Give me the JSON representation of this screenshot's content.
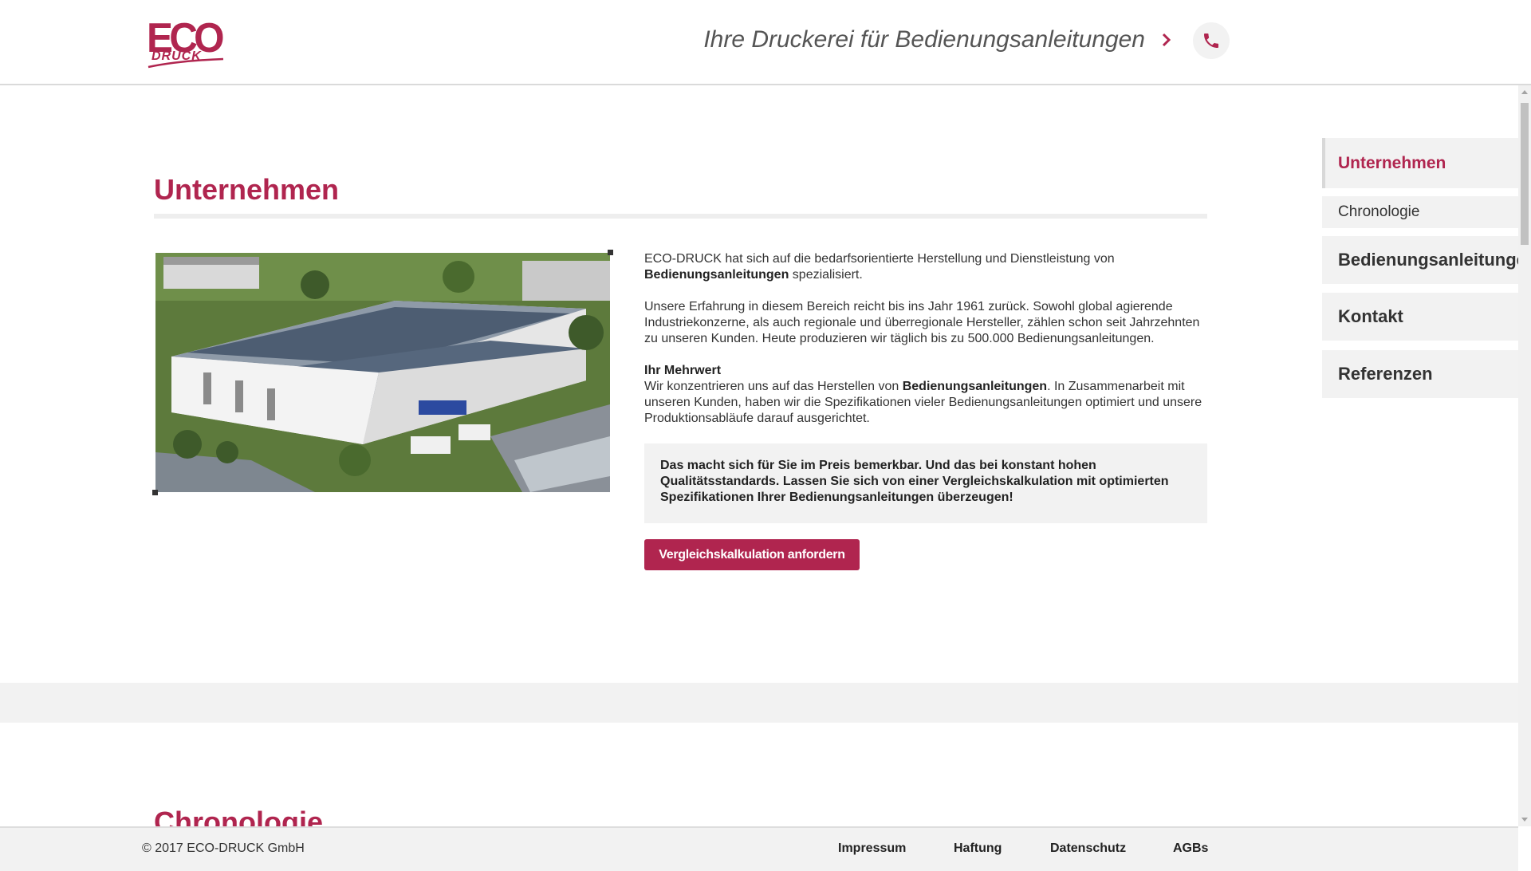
{
  "header": {
    "logo_text": "ECO",
    "logo_subtext": "DRUCK",
    "tagline": "Ihre Druckerei für Bedienungsanleitungen",
    "arrow_icon": "chevron-right-icon",
    "phone_icon": "phone-icon"
  },
  "main": {
    "title": "Unternehmen",
    "photo_icon": "factory-aerial-photo",
    "intro_pre": "ECO-DRUCK hat sich auf die bedarfsorientierte Herstellung und Dienstleistung von ",
    "intro_bold": "Bedienungsanleitungen",
    "intro_post": " spezialisiert.",
    "paragraph2": "Unsere Erfahrung in diesem Bereich reicht bis ins Jahr 1961 zurück. Sowohl global agierende Industriekonzerne, als auch regionale und überregionale Hersteller, zählen schon seit Jahrzehnten zu unseren Kunden. Heute produzieren wir täglich bis zu 500.000 Bedienungsanleitungen.",
    "mehrwert_heading": "Ihr Mehrwert",
    "mehrwert_pre": "Wir konzentrieren uns auf das Herstellen von ",
    "mehrwert_bold": "Bedienungsanleitungen",
    "mehrwert_post": ". In Zusammenarbeit mit unseren Kunden, haben wir die Spezifikationen vieler Bedienungsanleitungen optimiert und unsere Produktionsabläufe darauf ausgerichtet.",
    "callout": "Das macht sich für Sie im Preis bemerkbar. Und das bei konstant hohen Qualitätsstandards. Lassen Sie sich von einer Vergleichskalkulation mit optimierten Spezifikationen Ihrer Bedienungsanleitungen überzeugen!",
    "cta_label": "Vergleichskalkulation anfordern",
    "next_section_title": "Chronologie"
  },
  "sidebar": {
    "items": [
      {
        "label": "Unternehmen",
        "state": "active"
      },
      {
        "label": "Chronologie",
        "state": "sub"
      },
      {
        "label": "Bedienungsanleitungen",
        "state": "normal"
      },
      {
        "label": "Kontakt",
        "state": "normal"
      },
      {
        "label": "Referenzen",
        "state": "normal"
      }
    ]
  },
  "footer": {
    "copyright": "© 2017 ECO-DRUCK GmbH",
    "links": [
      "Impressum",
      "Haftung",
      "Datenschutz",
      "AGBs"
    ]
  },
  "colors": {
    "brand": "#b0254f",
    "text": "#333333",
    "panel": "#f2f2f2"
  }
}
